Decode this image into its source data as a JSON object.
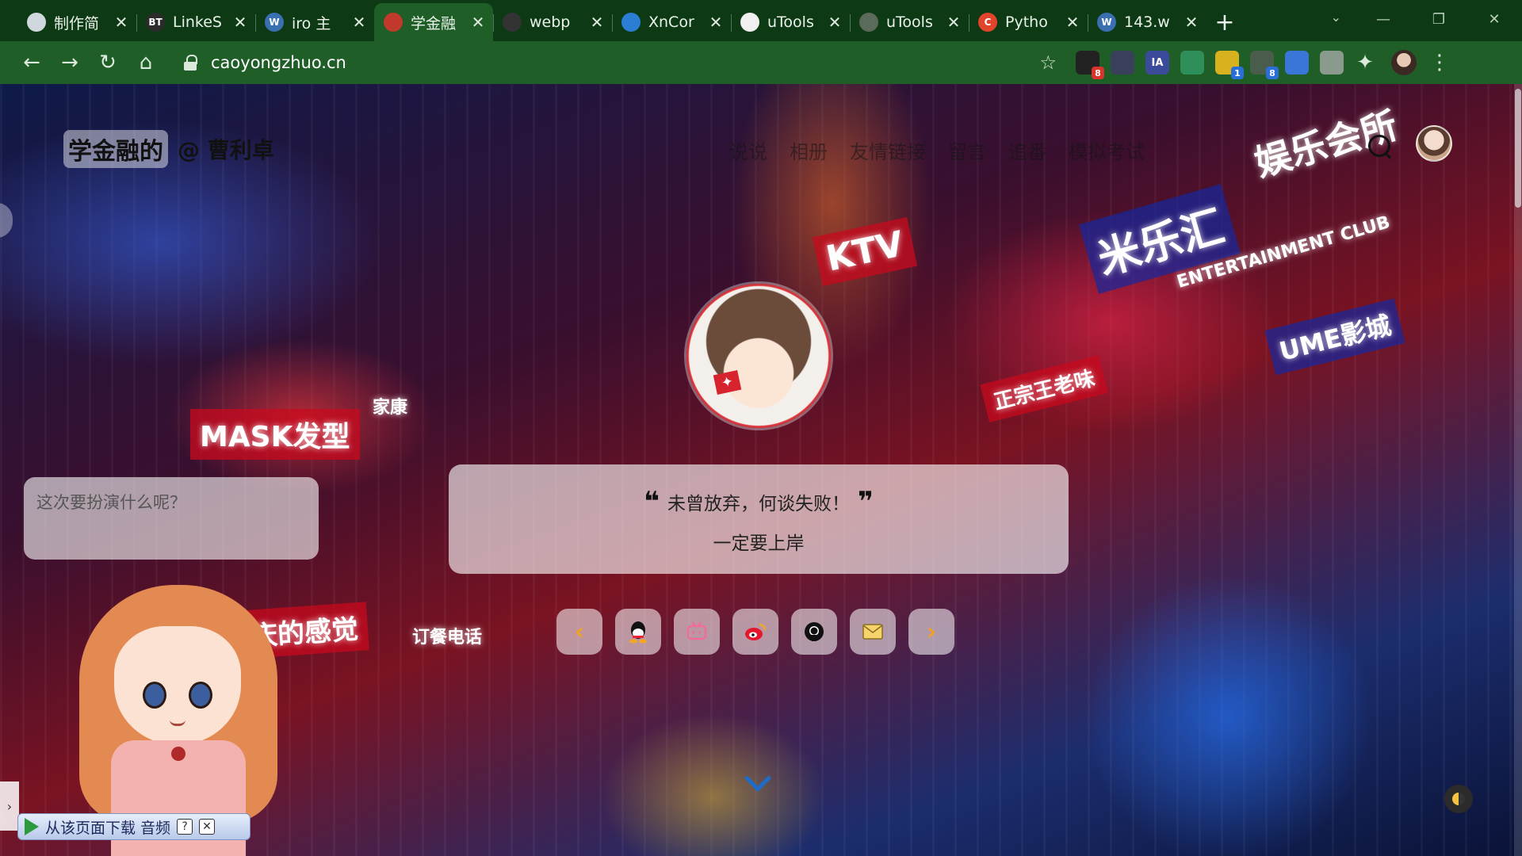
{
  "browser": {
    "tabs": [
      {
        "title": "制作简",
        "favicon_color": "#cfd8dc"
      },
      {
        "title": "LinkeS",
        "favicon_text": "BT",
        "favicon_color": "#2b2b2b"
      },
      {
        "title": "iro 主",
        "favicon_text": "W",
        "favicon_color": "#3a6fb0"
      },
      {
        "title": "学金融",
        "favicon_color": "#c0392b"
      },
      {
        "title": "webp",
        "favicon_color": "#333333"
      },
      {
        "title": "XnCor",
        "favicon_color": "#2a7fd4"
      },
      {
        "title": "uTools",
        "favicon_color": "#f0f0f0"
      },
      {
        "title": "uTools",
        "favicon_color": "#5a6b5c"
      },
      {
        "title": "Pytho",
        "favicon_text": "C",
        "favicon_color": "#e0452b"
      },
      {
        "title": "143.w",
        "favicon_text": "W",
        "favicon_color": "#3a6fb0"
      }
    ],
    "active_tab_index": 3,
    "url": "caoyongzhuo.cn",
    "extensions": [
      {
        "name": "ext-1",
        "color": "#222222",
        "badge": "8",
        "badge_color": "#d8342c"
      },
      {
        "name": "ext-2",
        "color": "#3a3f5c"
      },
      {
        "name": "ext-ia",
        "color": "#3b4a9a",
        "label": "IA"
      },
      {
        "name": "ext-4",
        "color": "#2f8f5a"
      },
      {
        "name": "ext-5",
        "color": "#d8b21e",
        "badge": "1",
        "badge_color": "#2a6fd8"
      },
      {
        "name": "ext-6",
        "color": "#4a5d4c",
        "badge": "8",
        "badge_color": "#2a6fd8"
      },
      {
        "name": "ext-translate",
        "color": "#3a75d8"
      },
      {
        "name": "ext-8",
        "color": "#8a9a8c"
      }
    ]
  },
  "site": {
    "logo": "学金融的",
    "author": "@ 曹利卓",
    "nav": [
      "说说",
      "相册",
      "友情链接",
      "留言",
      "追番",
      "模拟考试"
    ],
    "quote": "未曾放弃，何谈失败！",
    "quote_sub": "一定要上岸",
    "speech_bubble": "这次要扮演什么呢？",
    "audio_label": "从该页面下载 音频",
    "social": [
      "qq-icon",
      "bilibili-icon",
      "weibo-icon",
      "github-icon",
      "mail-icon"
    ],
    "background_signs": [
      "米乐汇",
      "娱乐会所",
      "ENTERTAINMENT CLUB",
      "KTV",
      "MASK发型",
      "UME影城",
      "重庆的感觉",
      "家康",
      "正宗王老味",
      "订餐电话"
    ]
  }
}
